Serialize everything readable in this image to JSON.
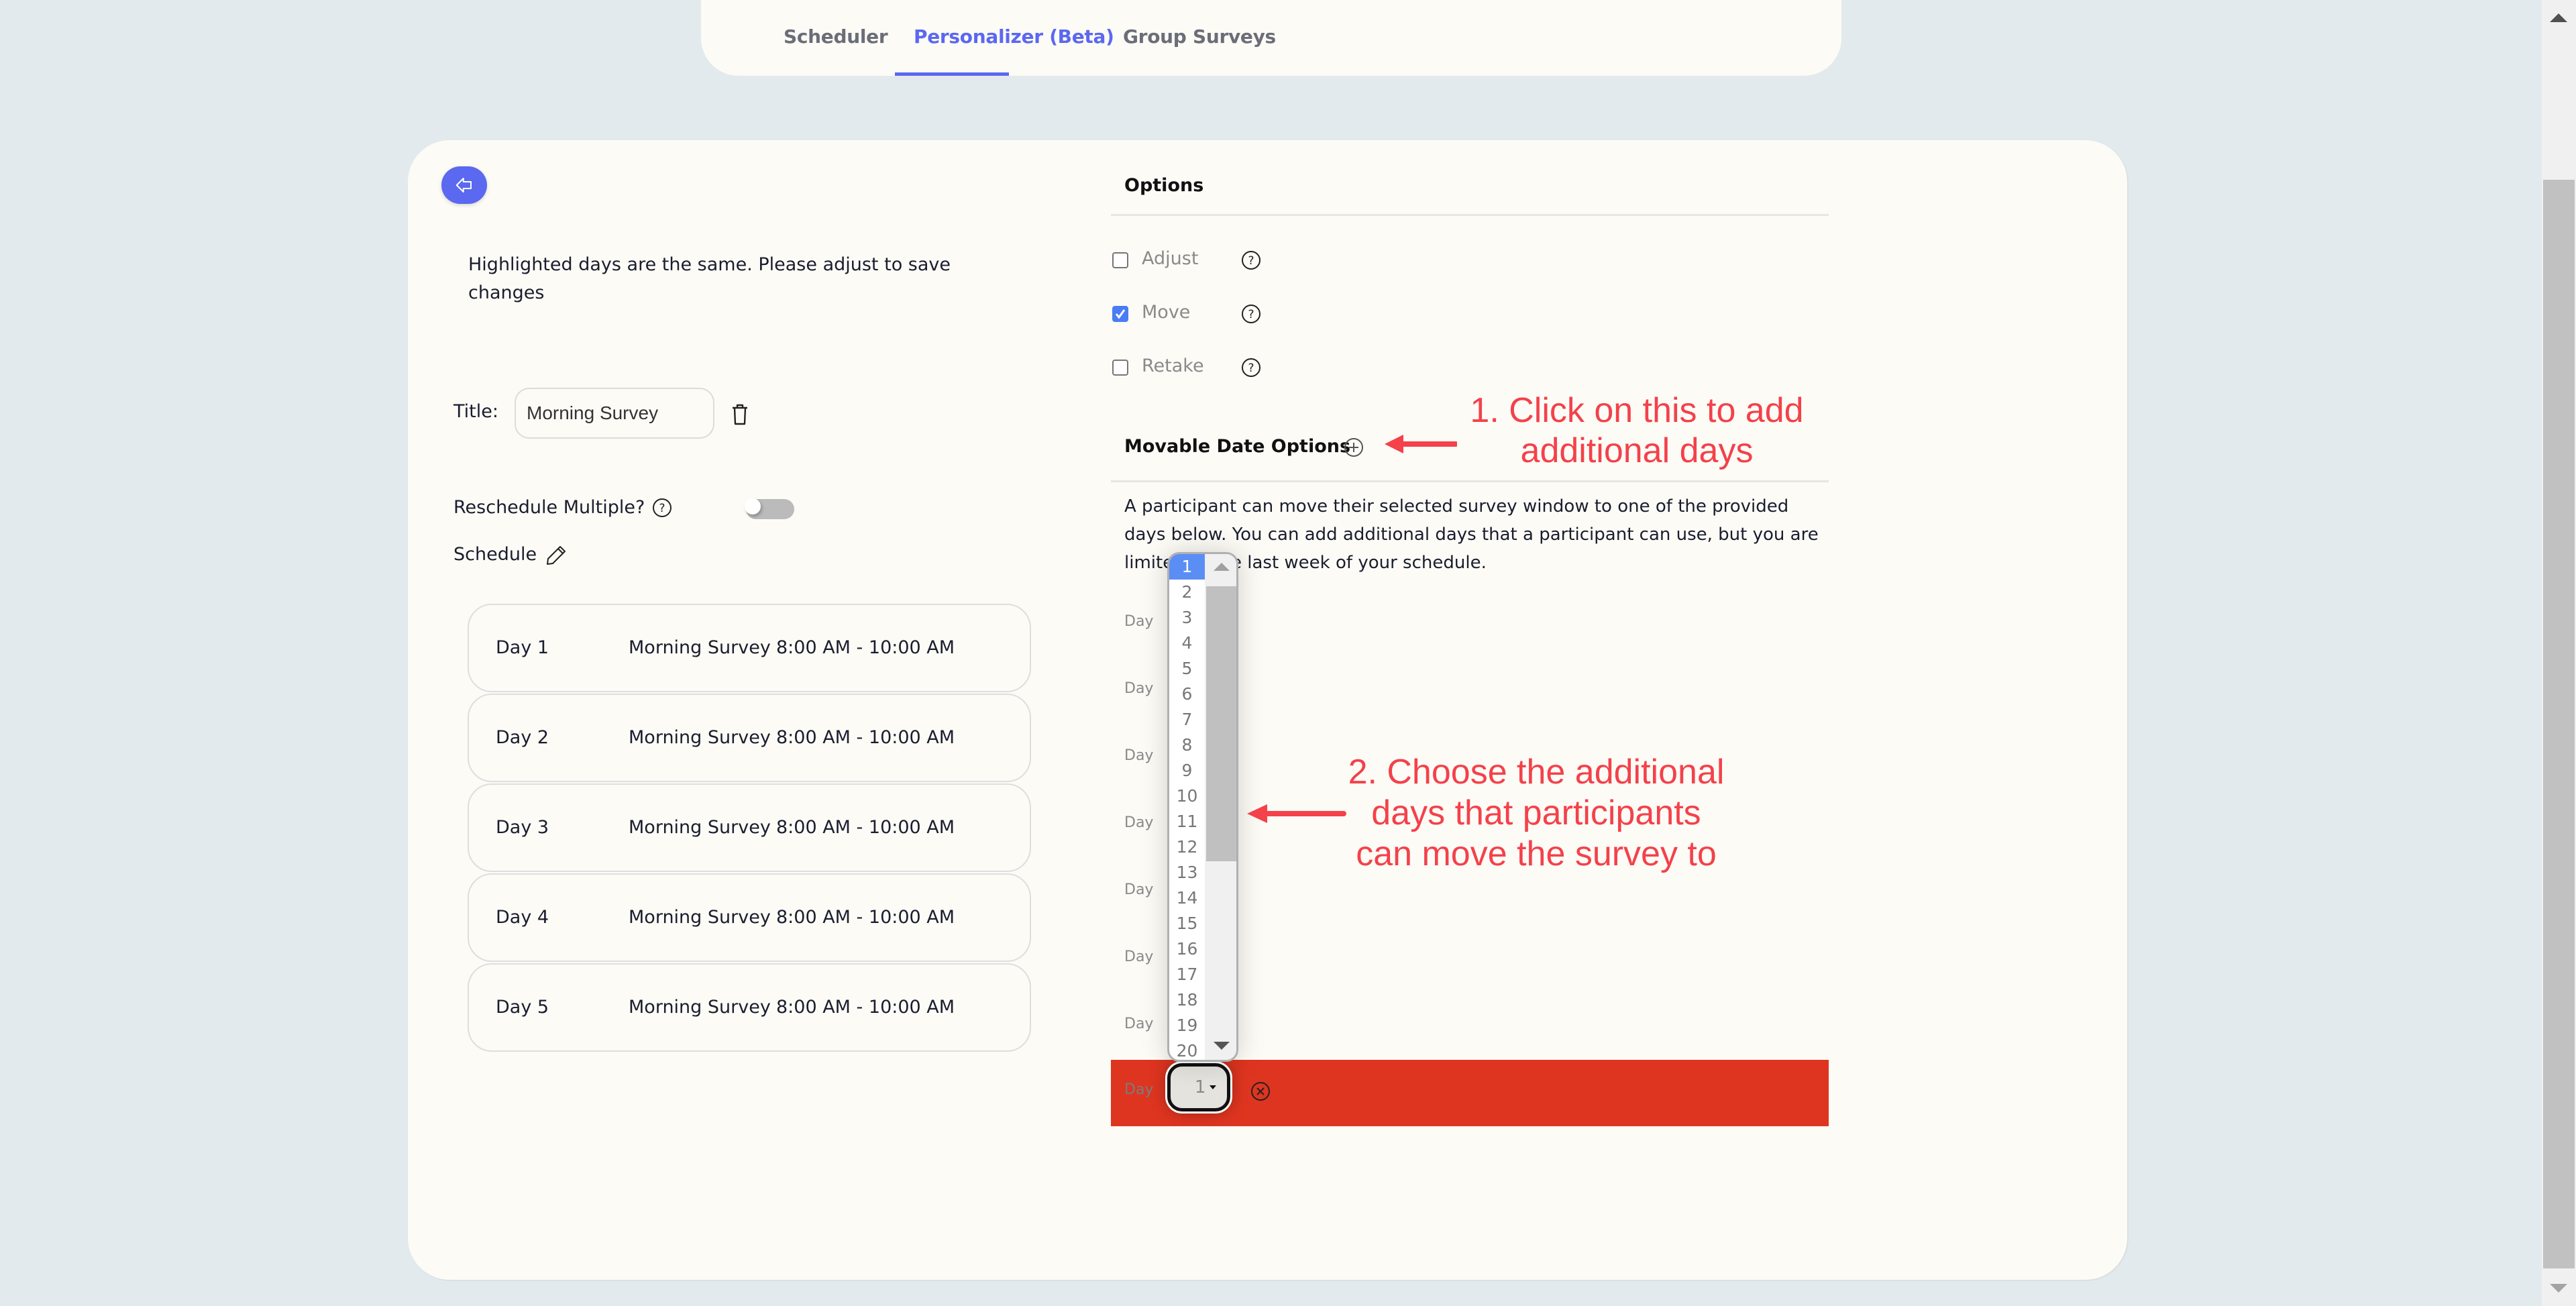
{
  "tabs": [
    {
      "label": "Scheduler",
      "active": false
    },
    {
      "label": "Personalizer (Beta)",
      "active": true
    },
    {
      "label": "Group Surveys",
      "active": false
    }
  ],
  "colors": {
    "accent": "#5b68f0",
    "error_row": "#de3520",
    "annotation": "#f4414a",
    "checkbox": "#4a7cf5"
  },
  "left": {
    "back_icon": "arrow-left-icon",
    "warning": "Highlighted days are the same. Please adjust to save changes",
    "title_label": "Title:",
    "title_value": "Morning Survey",
    "reschedule_label": "Reschedule Multiple?",
    "reschedule_enabled": false,
    "schedule_label": "Schedule",
    "schedule": [
      {
        "day": "Day 1",
        "survey": "Morning Survey",
        "time": "8:00 AM - 10:00 AM"
      },
      {
        "day": "Day 2",
        "survey": "Morning Survey",
        "time": "8:00 AM - 10:00 AM"
      },
      {
        "day": "Day 3",
        "survey": "Morning Survey",
        "time": "8:00 AM - 10:00 AM"
      },
      {
        "day": "Day 4",
        "survey": "Morning Survey",
        "time": "8:00 AM - 10:00 AM"
      },
      {
        "day": "Day 5",
        "survey": "Morning Survey",
        "time": "8:00 AM - 10:00 AM"
      }
    ]
  },
  "options": {
    "title": "Options",
    "items": [
      {
        "label": "Adjust",
        "checked": false
      },
      {
        "label": "Move",
        "checked": true
      },
      {
        "label": "Retake",
        "checked": false
      }
    ]
  },
  "movable": {
    "title": "Movable Date Options",
    "description": "A participant can move their selected survey window to one of the provided days below. You can add additional days that a participant can use, but you are limited to the last week of your schedule.",
    "day_label": "Day",
    "rows": 8,
    "selected_value": "1",
    "dropdown_options": [
      "1",
      "2",
      "3",
      "4",
      "5",
      "6",
      "7",
      "8",
      "9",
      "10",
      "11",
      "12",
      "13",
      "14",
      "15",
      "16",
      "17",
      "18",
      "19",
      "20"
    ],
    "dropdown_selected": "1"
  },
  "annotations": {
    "step1_line1": "1. Click on this to add",
    "step1_line2": "additional days",
    "step2_line1": "2. Choose the additional",
    "step2_line2": "days that participants",
    "step2_line3": "can move the survey to"
  }
}
